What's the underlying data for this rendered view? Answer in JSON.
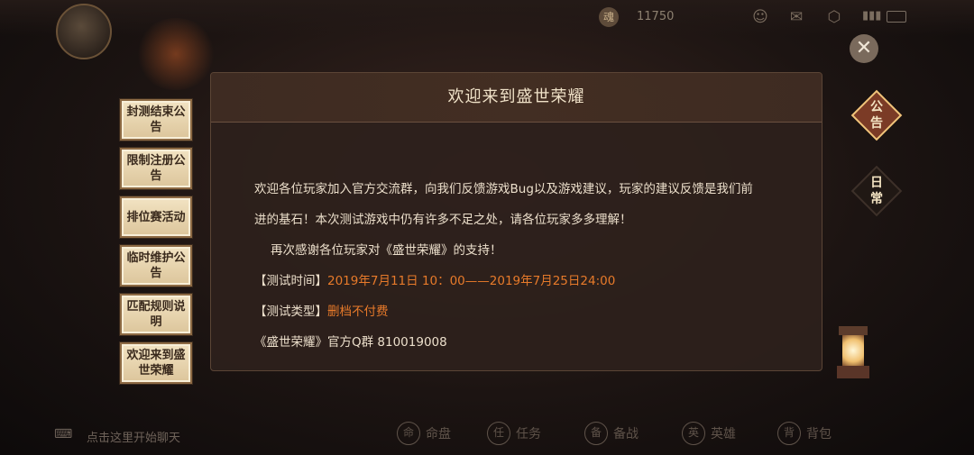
{
  "top_bar": {
    "currency_value": "11750",
    "coin_glyph": "魂",
    "icons": [
      "friends-icon",
      "mail-icon",
      "settings-icon"
    ]
  },
  "announcement": {
    "title": "欢迎来到盛世荣耀",
    "tabs": [
      {
        "label": "封测结束公告"
      },
      {
        "label": "限制注册公告"
      },
      {
        "label": "排位赛活动"
      },
      {
        "label": "临时维护公告"
      },
      {
        "label": "匹配规则说明"
      },
      {
        "label": "欢迎来到盛世荣耀"
      }
    ],
    "body": {
      "line1": "欢迎各位玩家加入官方交流群，向我们反馈游戏Bug以及游戏建议，玩家的建议反馈是我们前",
      "line2": "进的基石！本次测试游戏中仍有许多不足之处，请各位玩家多多理解！",
      "line3": "再次感谢各位玩家对《盛世荣耀》的支持！",
      "time_label": "【测试时间】",
      "time_value": "2019年7月11日 10：00——2019年7月25日24:00",
      "type_label": "【测试类型】",
      "type_value": "删档不付费",
      "qq_line": "《盛世荣耀》官方Q群 810019008"
    }
  },
  "right_tabs": {
    "notice": {
      "line1": "公",
      "line2": "告"
    },
    "daily": {
      "line1": "日",
      "line2": "常"
    }
  },
  "close_glyph": "✕",
  "chat": {
    "placeholder": "点击这里开始聊天",
    "icon_glyph": "⌨"
  },
  "bottom_nav": [
    {
      "label": "命盘",
      "icon": "命"
    },
    {
      "label": "任务",
      "icon": "任"
    },
    {
      "label": "备战",
      "icon": "备"
    },
    {
      "label": "英雄",
      "icon": "英"
    },
    {
      "label": "背包",
      "icon": "背"
    }
  ],
  "colors": {
    "highlight": "#e77a2a",
    "panel_text": "#ecdfcb",
    "tab_bg": "#f2e3c2"
  }
}
